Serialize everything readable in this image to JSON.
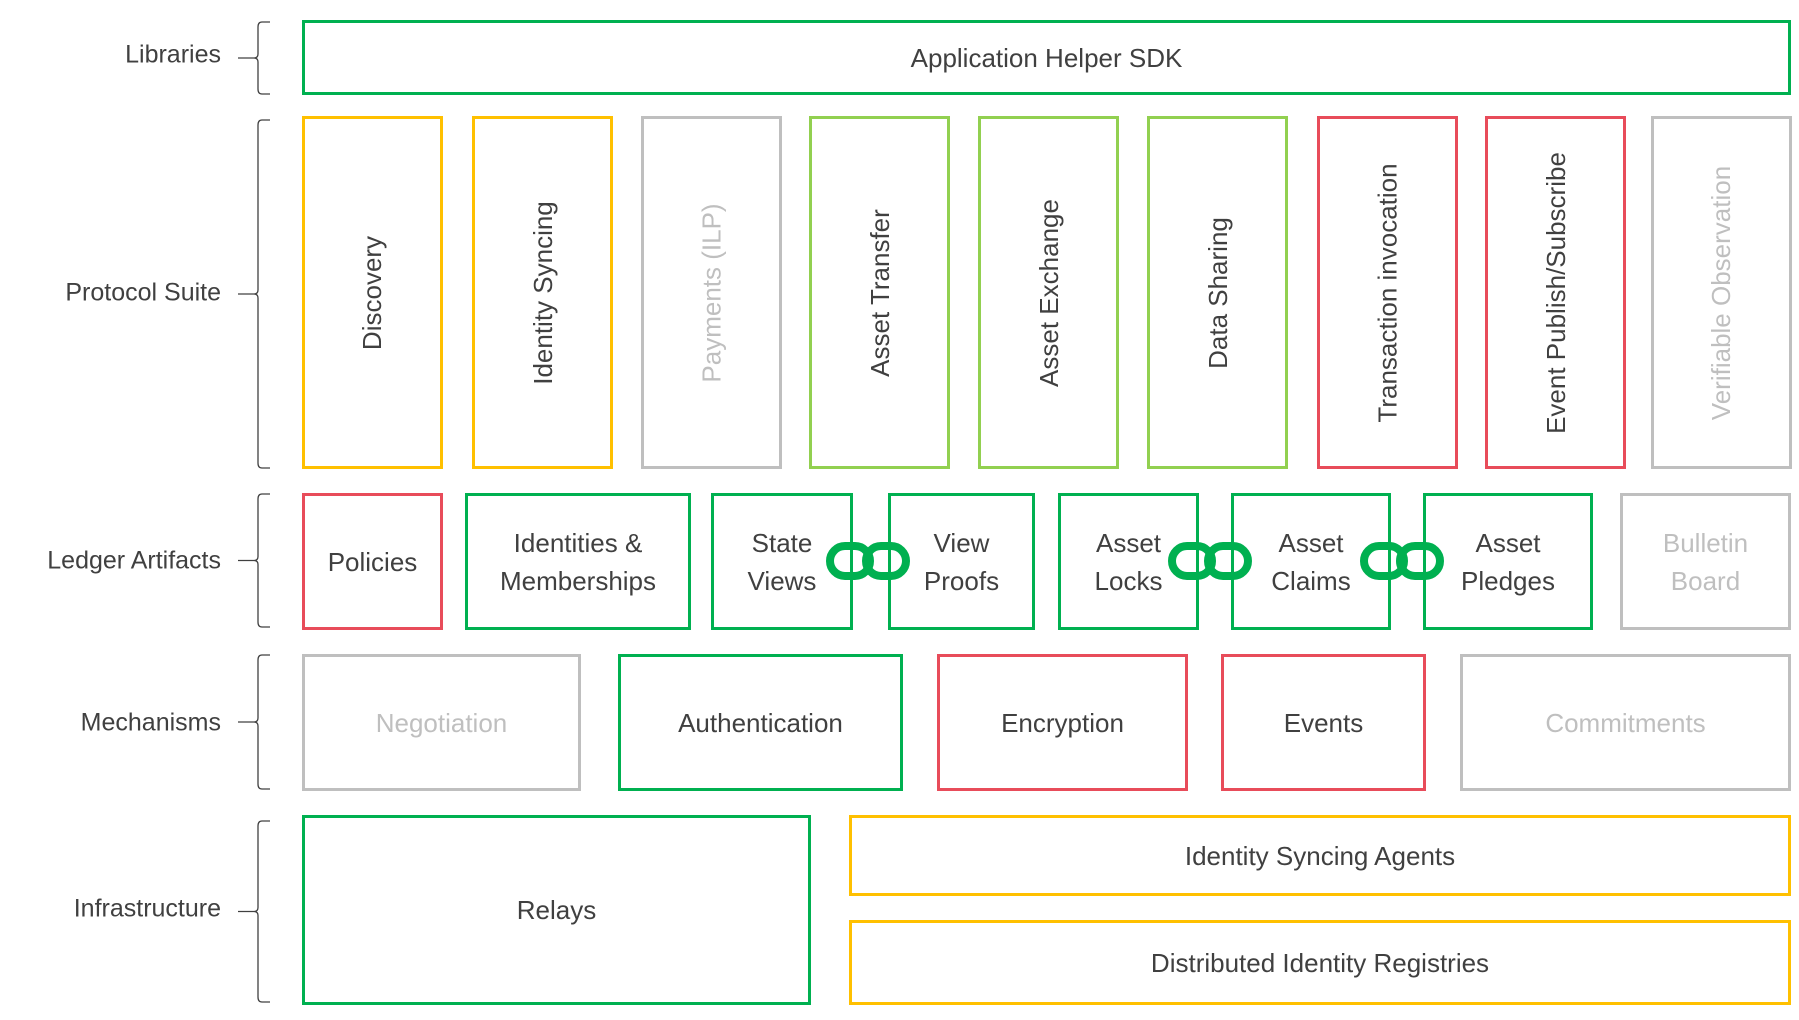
{
  "colors": {
    "green": "#00b050",
    "lightgreen": "#92d050",
    "orange": "#ffc000",
    "red": "#e84c5a",
    "gray": "#bfbfbf",
    "text": "#404040"
  },
  "layers": {
    "libraries": "Libraries",
    "protocol": "Protocol Suite",
    "ledger": "Ledger Artifacts",
    "mechanisms": "Mechanisms",
    "infrastructure": "Infrastructure"
  },
  "libraries": {
    "sdk": "Application Helper SDK"
  },
  "protocols": [
    {
      "label": "Discovery",
      "status": "orange"
    },
    {
      "label": "Identity Syncing",
      "status": "orange"
    },
    {
      "label": "Payments (ILP)",
      "status": "gray"
    },
    {
      "label": "Asset Transfer",
      "status": "lightgreen"
    },
    {
      "label": "Asset Exchange",
      "status": "lightgreen"
    },
    {
      "label": "Data Sharing",
      "status": "lightgreen"
    },
    {
      "label": "Transaction invocation",
      "status": "red"
    },
    {
      "label": "Event Publish/Subscribe",
      "status": "red"
    },
    {
      "label": "Verifiable Observation",
      "status": "gray"
    }
  ],
  "ledger": [
    {
      "label": "Policies",
      "status": "red"
    },
    {
      "label": "Identities & Memberships",
      "status": "green"
    },
    {
      "label": "State Views",
      "status": "green"
    },
    {
      "label": "View Proofs",
      "status": "green"
    },
    {
      "label": "Asset Locks",
      "status": "green"
    },
    {
      "label": "Asset Claims",
      "status": "green"
    },
    {
      "label": "Asset Pledges",
      "status": "green"
    },
    {
      "label": "Bulletin Board",
      "status": "gray"
    }
  ],
  "mechanisms": [
    {
      "label": "Negotiation",
      "status": "gray"
    },
    {
      "label": "Authentication",
      "status": "green"
    },
    {
      "label": "Encryption",
      "status": "red"
    },
    {
      "label": "Events",
      "status": "red"
    },
    {
      "label": "Commitments",
      "status": "gray"
    }
  ],
  "infrastructure": [
    {
      "label": "Relays",
      "status": "green"
    },
    {
      "label": "Identity Syncing Agents",
      "status": "orange"
    },
    {
      "label": "Distributed Identity Registries",
      "status": "orange"
    }
  ]
}
